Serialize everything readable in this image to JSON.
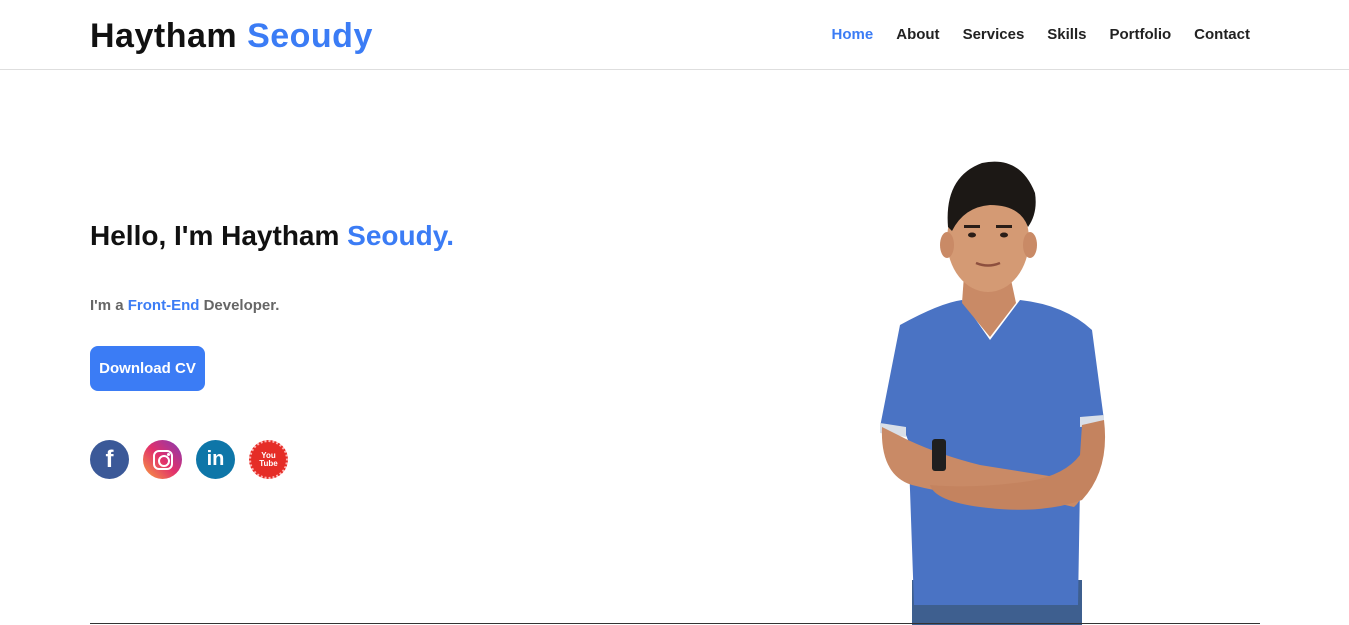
{
  "header": {
    "logo_first": "Haytham",
    "logo_accent": "Seoudy",
    "nav": [
      {
        "label": "Home",
        "active": true
      },
      {
        "label": "About",
        "active": false
      },
      {
        "label": "Services",
        "active": false
      },
      {
        "label": "Skills",
        "active": false
      },
      {
        "label": "Portfolio",
        "active": false
      },
      {
        "label": "Contact",
        "active": false
      }
    ]
  },
  "hero": {
    "title_prefix": "Hello, I'm Haytham ",
    "title_accent": "Seoudy.",
    "subtitle_prefix": "I'm a ",
    "subtitle_accent": "Front-End",
    "subtitle_suffix": " Developer.",
    "cta_label": "Download CV",
    "socials": [
      {
        "name": "facebook",
        "icon": "facebook-icon",
        "glyph": "f"
      },
      {
        "name": "instagram",
        "icon": "instagram-icon"
      },
      {
        "name": "linkedin",
        "icon": "linkedin-icon",
        "glyph": "in"
      },
      {
        "name": "youtube",
        "icon": "youtube-icon",
        "line1": "You",
        "line2": "Tube"
      }
    ]
  },
  "colors": {
    "accent": "#3b7cf5",
    "text": "#111111",
    "muted": "#666666"
  }
}
